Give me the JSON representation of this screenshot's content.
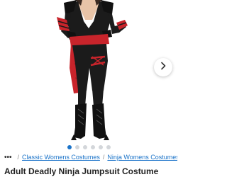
{
  "product": {
    "image_alt": "Adult Deadly Ninja Jumpsuit Costume",
    "carousel": {
      "total_images": 6,
      "active_index": 0
    }
  },
  "breadcrumb": {
    "more_label": "•••",
    "separator": "/",
    "items": [
      {
        "label": "Classic Womens Costumes"
      },
      {
        "label": "Ninja Womens Costumes"
      }
    ]
  },
  "title": "Adult Deadly Ninja Jumpsuit Costume",
  "icons": {
    "next": "chevron-right-icon",
    "more": "ellipsis-icon"
  },
  "colors": {
    "accent": "#1a73c9",
    "costume_black": "#1b1b1b",
    "costume_red": "#c8242b"
  }
}
